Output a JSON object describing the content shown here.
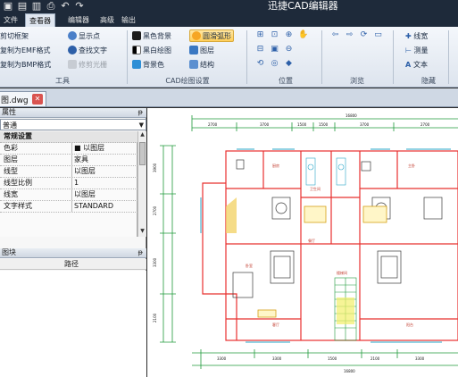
{
  "titlebar": {
    "title": "迅捷CAD编辑器",
    "quick_access": [
      "new-icon",
      "open-icon",
      "save-icon",
      "print-icon",
      "undo-icon",
      "redo-icon"
    ]
  },
  "tabs": [
    {
      "label": "文件",
      "active": false
    },
    {
      "label": "查看器",
      "active": true
    },
    {
      "label": "编辑器",
      "active": false
    },
    {
      "label": "高级",
      "active": false
    },
    {
      "label": "输出",
      "active": false
    }
  ],
  "ribbon": {
    "tools": {
      "label": "工具",
      "buttons": [
        "剪切框架",
        "复制为EMF格式",
        "复制为BMP格式",
        "显示点",
        "查找文字",
        "修剪光栅"
      ]
    },
    "cad": {
      "label": "CAD绘图设置",
      "buttons": [
        "黑色背景",
        "黑白绘图",
        "背景色",
        "圆滑弧形",
        "图层",
        "结构"
      ]
    },
    "position": {
      "label": "位置"
    },
    "browse": {
      "label": "浏览"
    },
    "hide": {
      "label": "隐藏",
      "buttons": [
        "线宽",
        "测量",
        "文本"
      ]
    }
  },
  "document": {
    "tab_name": "图.dwg"
  },
  "properties": {
    "header": "属性",
    "combo_value": "普通",
    "rows": [
      {
        "key": "常规设置",
        "value": "",
        "category": true
      },
      {
        "key": "色彩",
        "value": "■ 以图层",
        "category": false
      },
      {
        "key": "图层",
        "value": "家具",
        "category": false
      },
      {
        "key": "线型",
        "value": "以图层",
        "category": false
      },
      {
        "key": "线型比例",
        "value": "1",
        "category": false
      },
      {
        "key": "线宽",
        "value": "以图层",
        "category": false
      },
      {
        "key": "文字样式",
        "value": "STANDARD",
        "category": false
      }
    ]
  },
  "library": {
    "header": "图块",
    "column": "路径"
  },
  "drawing": {
    "dims_top": [
      "2700",
      "3700",
      "1500",
      "1500",
      "3700",
      "2700"
    ],
    "dims_top_total": "16800",
    "dims_bottom": [
      "3300",
      "3300",
      "1500",
      "2100",
      "3300"
    ],
    "dims_bottom_total": "16800",
    "dims_left": [
      "3900",
      "2700",
      "3300",
      "2100"
    ],
    "room_labels": [
      "厨房",
      "卫生间",
      "餐厅",
      "客厅",
      "卧室",
      "主卧",
      "阳台",
      "楼梯间"
    ],
    "colors": {
      "wall": "#e8302f",
      "dim": "#1f9a3a",
      "furniture": "#3a3a3a",
      "window": "#2aa7c9",
      "door": "#d4a017"
    }
  }
}
